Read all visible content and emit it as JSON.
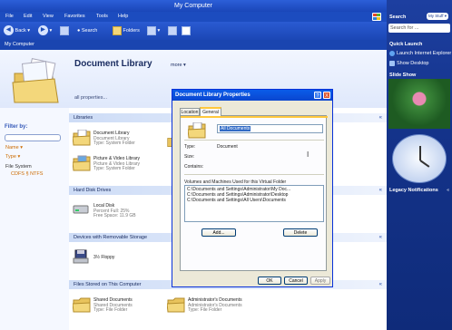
{
  "window": {
    "title": "My Computer",
    "menu": [
      "File",
      "Edit",
      "View",
      "Favorites",
      "Tools",
      "Help"
    ],
    "toolbar": {
      "back": "Back",
      "search": "Search",
      "folders": "Folders"
    },
    "address": "My Computer"
  },
  "hero": {
    "title": "Document Library",
    "more": "more",
    "all_properties": "all properties..."
  },
  "left_pane": {
    "filter_by": "Filter by:",
    "filters": [
      "Name ▾",
      "Type ▾"
    ],
    "file_system_label": "File System",
    "file_system_values": "CDFS § NTFS"
  },
  "sections": {
    "libraries": "Libraries",
    "hard_disk_drives": "Hard Disk Drives",
    "removable": "Devices with Removable Storage",
    "files_stored": "Files Stored on This Computer"
  },
  "items": {
    "doc_lib": [
      "Document Library",
      "Document Library",
      "Type: System Folder"
    ],
    "pic_lib": [
      "Picture & Video Library",
      "Picture & Video Library",
      "Type: System Folder"
    ],
    "local_disk": [
      "Local Disk",
      "Percent Full: 25%",
      "Free Space: 11.9 GB"
    ],
    "floppy": [
      "3½ Floppy"
    ],
    "shared_docs": [
      "Shared Documents",
      "Shared Documents",
      "Type: File Folder"
    ],
    "admin_docs": [
      "Administrator's Documents",
      "Administrator's Documents",
      "Type: File Folder"
    ]
  },
  "sidebar": {
    "search": "Search",
    "my_stuff": "My Stuff",
    "search_placeholder": "Search for ...",
    "quick_launch": "Quick Launch",
    "launch_ie": "Launch Internet Explorer",
    "show_desktop": "Show Desktop",
    "slide_show": "Slide Show",
    "legacy": "Legacy Notifications"
  },
  "dialog": {
    "title": "Document Library Properties",
    "help": "?",
    "close": "X",
    "tabs": [
      "Location",
      "General"
    ],
    "name_value": "All Documents",
    "type_label": "Type:",
    "type_value": "Document",
    "size_label": "Size:",
    "contains_label": "Contains:",
    "volumes_label": "Volumes and Machines Used for this Virtual Folder",
    "volumes": [
      "C:\\Documents and Settings\\Administrator\\My Doc...",
      "C:\\Documents and Settings\\Administrator\\Desktop",
      "C:\\Documents and Settings\\All Users\\Documents"
    ],
    "add": "Add...",
    "delete": "Delete",
    "ok": "OK",
    "cancel": "Cancel",
    "apply": "Apply"
  },
  "colors": {
    "title_blue": "#1a46b8",
    "sidebar_blue": "#14338a",
    "filter_orange": "#cc6b00",
    "dialog_bg": "#ece9d8"
  }
}
